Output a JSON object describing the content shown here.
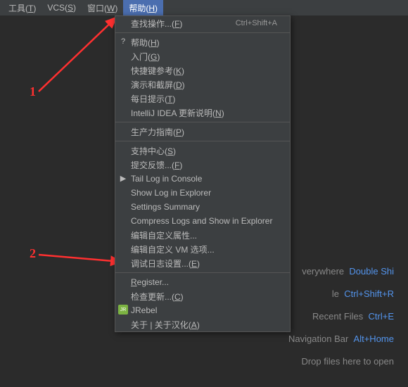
{
  "menubar": {
    "items": [
      {
        "pre": "工具(",
        "mn": "T",
        "post": ")"
      },
      {
        "pre": "VCS(",
        "mn": "S",
        "post": ")"
      },
      {
        "pre": "窗口(",
        "mn": "W",
        "post": ")"
      },
      {
        "pre": "帮助(",
        "mn": "H",
        "post": ")"
      }
    ]
  },
  "dropdown": {
    "rows": [
      {
        "kind": "item",
        "pre": "查找操作...(",
        "mn": "F",
        "post": ")",
        "shortcut": "Ctrl+Shift+A",
        "icon": ""
      },
      {
        "kind": "sep"
      },
      {
        "kind": "item",
        "pre": "帮助(",
        "mn": "H",
        "post": ")",
        "shortcut": "",
        "icon": "?"
      },
      {
        "kind": "item",
        "pre": "入门(",
        "mn": "G",
        "post": ")",
        "shortcut": "",
        "icon": ""
      },
      {
        "kind": "item",
        "pre": "快捷键参考(",
        "mn": "K",
        "post": ")",
        "shortcut": "",
        "icon": ""
      },
      {
        "kind": "item",
        "pre": "演示和截屏(",
        "mn": "D",
        "post": ")",
        "shortcut": "",
        "icon": ""
      },
      {
        "kind": "item",
        "pre": "每日提示(",
        "mn": "T",
        "post": ")",
        "shortcut": "",
        "icon": ""
      },
      {
        "kind": "item",
        "pre": "IntelliJ IDEA 更新说明(",
        "mn": "N",
        "post": ")",
        "shortcut": "",
        "icon": ""
      },
      {
        "kind": "sep"
      },
      {
        "kind": "item",
        "pre": "生产力指南(",
        "mn": "P",
        "post": ")",
        "shortcut": "",
        "icon": ""
      },
      {
        "kind": "sep"
      },
      {
        "kind": "item",
        "pre": "支持中心(",
        "mn": "S",
        "post": ")",
        "shortcut": "",
        "icon": ""
      },
      {
        "kind": "item",
        "pre": "提交反馈...(",
        "mn": "F",
        "post": ")",
        "shortcut": "",
        "icon": ""
      },
      {
        "kind": "item",
        "pre": "Tail Log in Console",
        "mn": "",
        "post": "",
        "shortcut": "",
        "icon": "▶"
      },
      {
        "kind": "item",
        "pre": "Show Log in Explorer",
        "mn": "",
        "post": "",
        "shortcut": "",
        "icon": ""
      },
      {
        "kind": "item",
        "pre": "Settings Summary",
        "mn": "",
        "post": "",
        "shortcut": "",
        "icon": ""
      },
      {
        "kind": "item",
        "pre": "Compress Logs and Show in Explorer",
        "mn": "",
        "post": "",
        "shortcut": "",
        "icon": ""
      },
      {
        "kind": "item",
        "pre": "编辑自定义属性...",
        "mn": "",
        "post": "",
        "shortcut": "",
        "icon": ""
      },
      {
        "kind": "item",
        "pre": "编辑自定义 VM 选项...",
        "mn": "",
        "post": "",
        "shortcut": "",
        "icon": ""
      },
      {
        "kind": "item",
        "pre": "调试日志设置...(",
        "mn": "E",
        "post": ")",
        "shortcut": "",
        "icon": ""
      },
      {
        "kind": "sep"
      },
      {
        "kind": "item",
        "pre": "",
        "mn": "R",
        "post": "egister...",
        "shortcut": "",
        "icon": ""
      },
      {
        "kind": "item",
        "pre": "检查更新...(",
        "mn": "C",
        "post": ")",
        "shortcut": "",
        "icon": ""
      },
      {
        "kind": "item",
        "pre": "JRebel",
        "mn": "",
        "post": "",
        "shortcut": "",
        "icon": "JR"
      },
      {
        "kind": "item",
        "pre": "关于 | 关于汉化(",
        "mn": "A",
        "post": ")",
        "shortcut": "",
        "icon": ""
      }
    ]
  },
  "hints": [
    {
      "label": "verywhere",
      "kb": "Double Shi"
    },
    {
      "label": "le",
      "kb": "Ctrl+Shift+R"
    },
    {
      "label": "Recent Files",
      "kb": "Ctrl+E"
    },
    {
      "label": "Navigation Bar",
      "kb": "Alt+Home"
    },
    {
      "label": "Drop files here to open",
      "kb": ""
    }
  ],
  "annotations": {
    "one": "1",
    "two": "2"
  }
}
